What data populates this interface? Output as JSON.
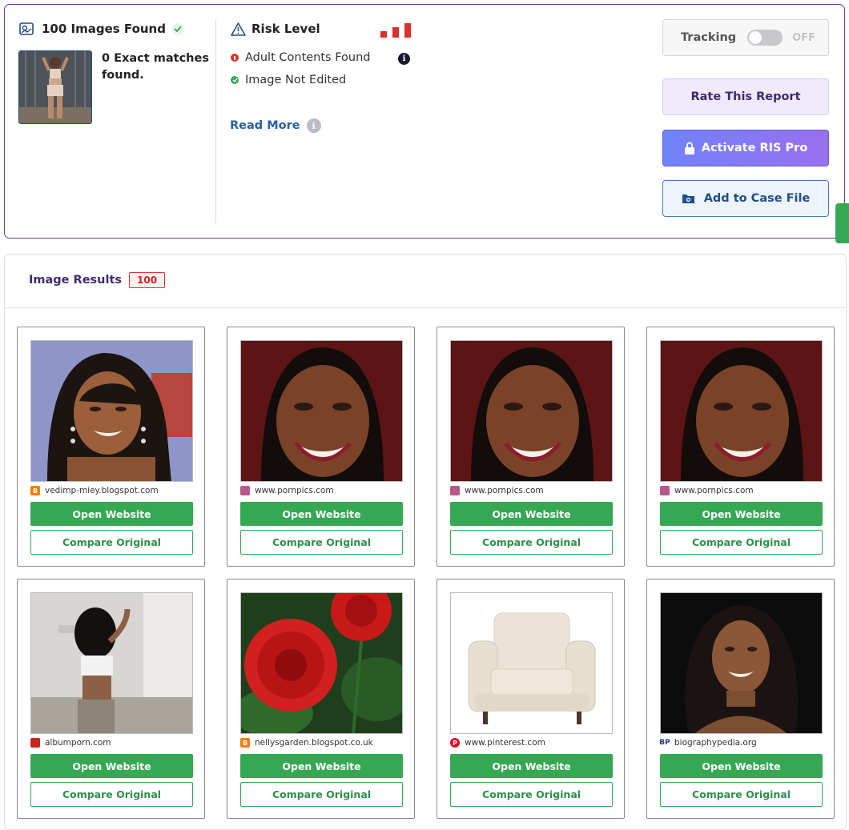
{
  "summary": {
    "images_found": "100 Images Found",
    "exact_matches": "0 Exact matches found.",
    "risk_title": "Risk Level",
    "adult": "Adult Contents Found",
    "not_edited": "Image Not Edited",
    "read_more": "Read More",
    "info_glyph": "i",
    "tracking_label": "Tracking",
    "tracking_state": "OFF",
    "rate_label": "Rate This Report",
    "pro_label": "Activate RIS Pro",
    "case_label": "Add to Case File"
  },
  "colors": {
    "accent_purple": "#6b3c8e",
    "green": "#35a853",
    "risk_red": "#d9302c",
    "link_blue": "#2a5ea8"
  },
  "results": {
    "title": "Image Results",
    "count": "100",
    "open_label": "Open Website",
    "compare_label": "Compare Original",
    "items": [
      {
        "site": "vedimp-miey.blogspot.com",
        "icon": "blogger-icon"
      },
      {
        "site": "www.pornpics.com",
        "icon": "pornpics-icon"
      },
      {
        "site": "www.pornpics.com",
        "icon": "pornpics-icon"
      },
      {
        "site": "www.pornpics.com",
        "icon": "pornpics-icon"
      },
      {
        "site": "albumporn.com",
        "icon": "albumporn-icon"
      },
      {
        "site": "nellysgarden.blogspot.co.uk",
        "icon": "blogger-icon"
      },
      {
        "site": "www.pinterest.com",
        "icon": "pinterest-icon"
      },
      {
        "site": "biographypedia.org",
        "icon": "bp-icon"
      }
    ]
  }
}
